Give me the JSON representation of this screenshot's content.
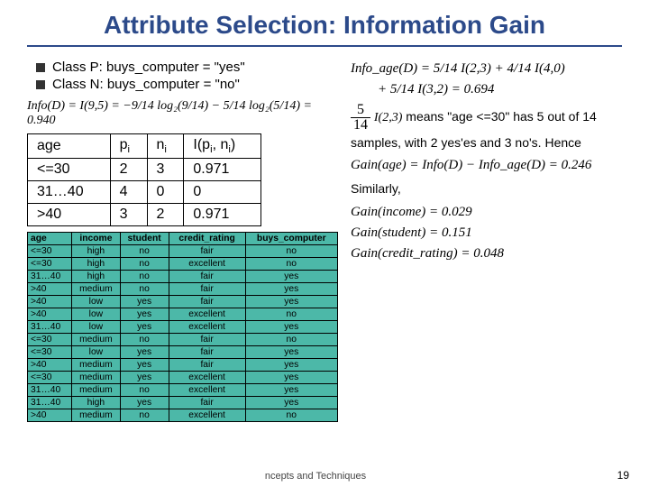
{
  "title": "Attribute Selection: Information Gain",
  "bullets": [
    "Class P: buys_computer = \"yes\"",
    "Class N: buys_computer = \"no\""
  ],
  "info_formula": "Info(D) = I(9,5) = −9/14 log₂(9/14) − 5/14 log₂(5/14) = 0.940",
  "infoage_formula_1": "Info_age(D) = 5/14 I(2,3) + 4/14 I(4,0)",
  "infoage_formula_2": "+ 5/14 I(3,2) = 0.694",
  "age_table": {
    "headers": [
      "age",
      "p_i",
      "n_i",
      "I(p_i, n_i)"
    ],
    "rows": [
      [
        "<=30",
        "2",
        "3",
        "0.971"
      ],
      [
        "31…40",
        "4",
        "0",
        "0"
      ],
      [
        ">40",
        "3",
        "2",
        "0.971"
      ]
    ]
  },
  "big_table": {
    "headers": [
      "age",
      "income",
      "student",
      "credit_rating",
      "buys_computer"
    ],
    "rows": [
      [
        "<=30",
        "high",
        "no",
        "fair",
        "no"
      ],
      [
        "<=30",
        "high",
        "no",
        "excellent",
        "no"
      ],
      [
        "31…40",
        "high",
        "no",
        "fair",
        "yes"
      ],
      [
        ">40",
        "medium",
        "no",
        "fair",
        "yes"
      ],
      [
        ">40",
        "low",
        "yes",
        "fair",
        "yes"
      ],
      [
        ">40",
        "low",
        "yes",
        "excellent",
        "no"
      ],
      [
        "31…40",
        "low",
        "yes",
        "excellent",
        "yes"
      ],
      [
        "<=30",
        "medium",
        "no",
        "fair",
        "no"
      ],
      [
        "<=30",
        "low",
        "yes",
        "fair",
        "yes"
      ],
      [
        ">40",
        "medium",
        "yes",
        "fair",
        "yes"
      ],
      [
        "<=30",
        "medium",
        "yes",
        "excellent",
        "yes"
      ],
      [
        "31…40",
        "medium",
        "no",
        "excellent",
        "yes"
      ],
      [
        "31…40",
        "high",
        "yes",
        "fair",
        "yes"
      ],
      [
        ">40",
        "medium",
        "no",
        "excellent",
        "no"
      ]
    ]
  },
  "explain_frac": {
    "n": "5",
    "d": "14"
  },
  "explain_ij": "I(2,3)",
  "explain_text": " means \"age <=30\" has 5 out of 14 samples, with 2 yes'es and 3 no's.  Hence",
  "gain_age": "Gain(age) = Info(D) − Info_age(D) = 0.246",
  "similarly": "Similarly,",
  "gains": [
    "Gain(income) = 0.029",
    "Gain(student) = 0.151",
    "Gain(credit_rating) = 0.048"
  ],
  "footer": "ncepts and Techniques",
  "pagenum": "19",
  "chart_data": {
    "type": "table",
    "title": "Information Gain computation over training data",
    "entropy_total": 0.94,
    "info_age": 0.694,
    "gains": {
      "age": 0.246,
      "income": 0.029,
      "student": 0.151,
      "credit_rating": 0.048
    },
    "age_split": [
      {
        "age": "<=30",
        "p": 2,
        "n": 3,
        "I": 0.971
      },
      {
        "age": "31…40",
        "p": 4,
        "n": 0,
        "I": 0
      },
      {
        "age": ">40",
        "p": 3,
        "n": 2,
        "I": 0.971
      }
    ]
  }
}
